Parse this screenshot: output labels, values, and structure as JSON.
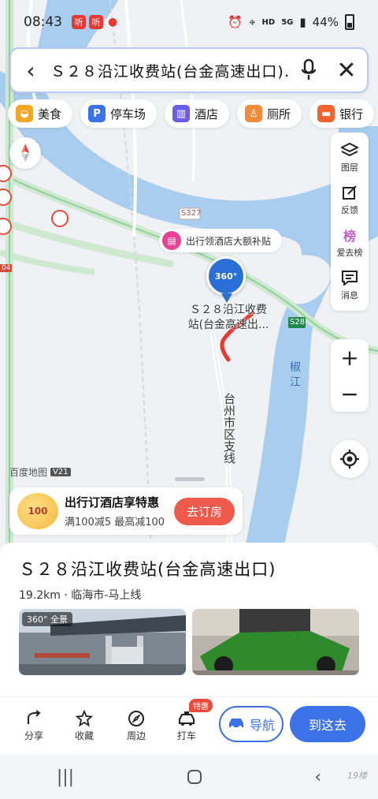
{
  "status_bar": {
    "time": "08:43",
    "app1": "听",
    "app2": "听",
    "hd": "HD",
    "net": "5G",
    "battery": "44%"
  },
  "search": {
    "query": "Ｓ２８沿江收费站(台金高速出口)..."
  },
  "chips": [
    {
      "label": "美食",
      "icon": "food-icon",
      "color": "#f5a623"
    },
    {
      "label": "停车场",
      "icon": "P",
      "color": "#3b72e8"
    },
    {
      "label": "酒店",
      "icon": "hotel-icon",
      "color": "#6b5ce7"
    },
    {
      "label": "厕所",
      "icon": "toilet-icon",
      "color": "#f08a3c"
    },
    {
      "label": "银行",
      "icon": "bank-icon",
      "color": "#f0652f"
    }
  ],
  "tools": {
    "layers": "图层",
    "feedback": "反馈",
    "ranking": "爱去榜",
    "ranking_badge": "榜",
    "messages": "消息"
  },
  "zoom": {
    "in": "+",
    "out": "−"
  },
  "map": {
    "road_s327": "S327",
    "road_s28": "S28",
    "river_label_1": "椒",
    "river_label_2": "江",
    "road_name": "台州市区支线",
    "marker_badge": "360°",
    "marker_name_line1": "Ｓ２８沿江收费",
    "marker_name_line2": "站(台金高速出...",
    "promo_pill": "出行领酒店大额补贴",
    "logo": "百度地图",
    "logo_version": "V21",
    "side_tag": "04"
  },
  "hotel_promo": {
    "title": "出行订酒店享特惠",
    "subtitle": "满100减5 最高减100",
    "coupon": "100",
    "button": "去订房"
  },
  "place": {
    "title": "Ｓ２８沿江收费站(台金高速出口)",
    "meta": "19.2km · 临海市-马上线",
    "photo_tag": "360° 全景"
  },
  "actions": {
    "share": "分享",
    "favorite": "收藏",
    "nearby": "周边",
    "taxi": "打车",
    "taxi_badge": "特惠",
    "navigate": "导航",
    "go_here": "到这去"
  },
  "watermark": "19楼"
}
